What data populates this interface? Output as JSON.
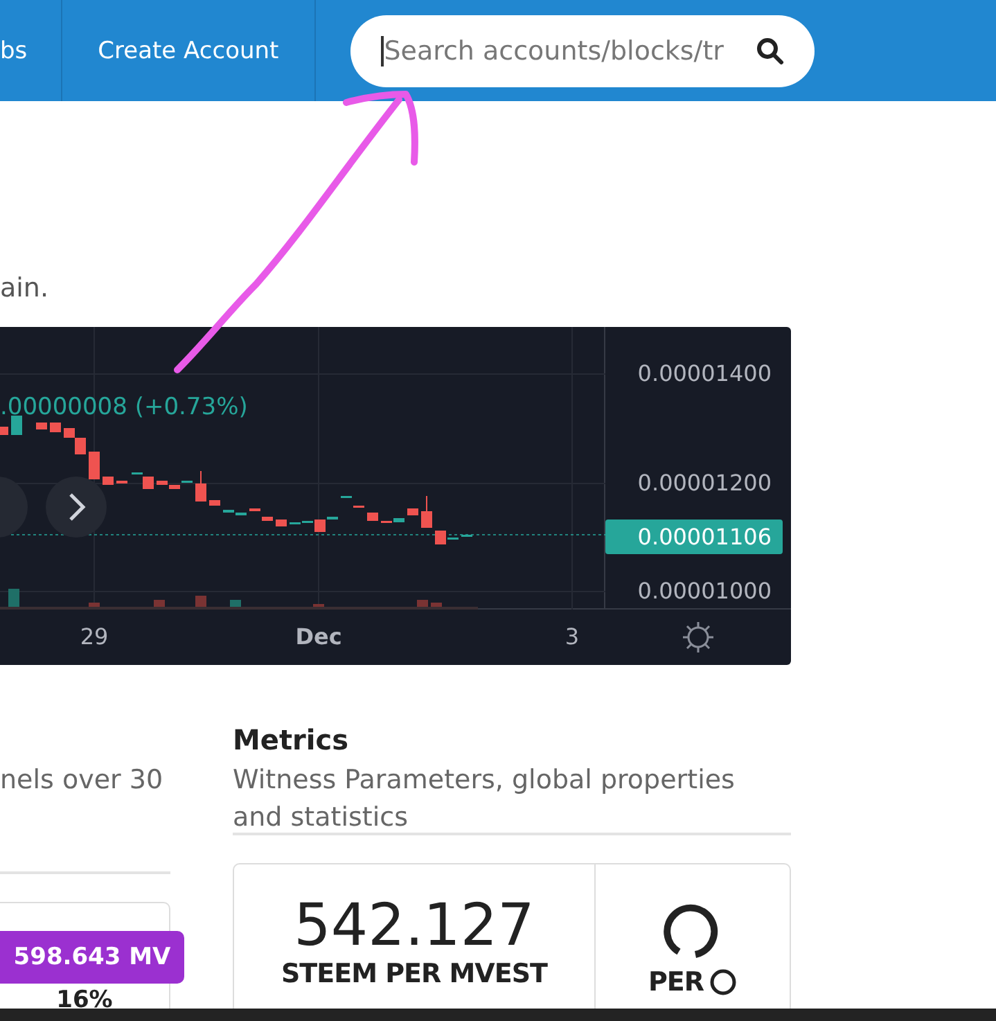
{
  "navbar": {
    "items": [
      {
        "label": "bs"
      },
      {
        "label": "Create Account"
      }
    ],
    "search": {
      "placeholder": "Search accounts/blocks/tr"
    }
  },
  "intro": {
    "text": "ain."
  },
  "price_chart": {
    "change": ".00000008 (+0.73%)",
    "price_ticks": [
      "0.00001400",
      "0.00001200",
      "0.00001000"
    ],
    "current_price": "0.00001106",
    "date_ticks": [
      "29",
      "Dec",
      "3"
    ]
  },
  "left_section": {
    "description": "nels over 30",
    "badge": "598.643 MV",
    "value": "16%"
  },
  "metrics": {
    "title": "Metrics",
    "description": "Witness Parameters, global properties and statistics",
    "cards": [
      {
        "value": "542.127",
        "label": "STEEM PER MVEST"
      },
      {
        "label": "PER"
      }
    ]
  }
}
